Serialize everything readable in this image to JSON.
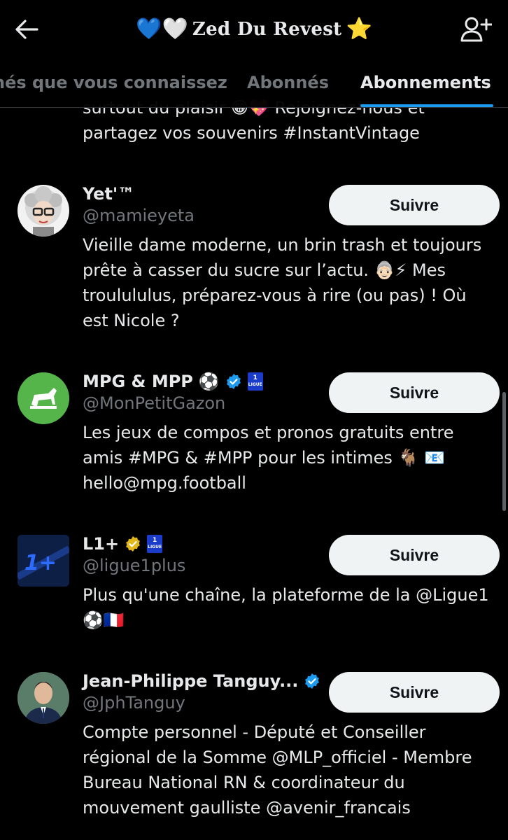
{
  "header": {
    "title_emojis_left": "💙🤍",
    "title": "Zed Du Revest",
    "title_emoji_right": "⭐",
    "back_icon": "arrow-left-icon",
    "add_user_icon": "add-user-icon"
  },
  "tabs": [
    {
      "label": "nés que vous connaissez",
      "active": false
    },
    {
      "label": "Abonnés",
      "active": false
    },
    {
      "label": "Abonnements",
      "active": true
    }
  ],
  "colors": {
    "accent": "#1d9bf0",
    "verified_blue": "#1d9bf0",
    "verified_gold": "#e2b719",
    "muted": "#71767b"
  },
  "prev_bio": {
    "line1": "surtout du plaisir 😁💖 Rejoignez-nous et",
    "line2": "partagez vos souvenirs #InstantVintage"
  },
  "users": [
    {
      "name": "Yet'™",
      "handle": "@mamieyeta",
      "bio": "Vieille dame moderne, un brin trash et toujours prête à casser du sucre sur l’actu. 👵🏻⚡ Mes troulululus, préparez-vous à rire (ou pas) ! Où est Nicole ?",
      "follow_label": "Suivre"
    },
    {
      "name": "MPG & MPP",
      "name_emoji": "⚽",
      "badge": "verified-blue",
      "league_badge": "L1",
      "handle": "@MonPetitGazon",
      "bio": "Les jeux de compos et pronos gratuits entre amis #MPG & #MPP pour les intimes 🐐 📧 hello@mpg.football",
      "follow_label": "Suivre"
    },
    {
      "name": "L1+",
      "badge": "verified-gold",
      "league_badge": "L1",
      "handle": "@ligue1plus",
      "bio": "Plus qu'une chaîne, la plateforme de la @Ligue1 ⚽🇫🇷",
      "follow_label": "Suivre"
    },
    {
      "name": "Jean-Philippe Tanguy...",
      "badge": "verified-blue",
      "handle": "@JphTanguy",
      "bio": "Compte personnel - Député et Conseiller régional de la Somme @MLP_officiel - Membre Bureau National RN & coordinateur du mouvement gaulliste @avenir_francais",
      "follow_label": "Suivre"
    }
  ]
}
